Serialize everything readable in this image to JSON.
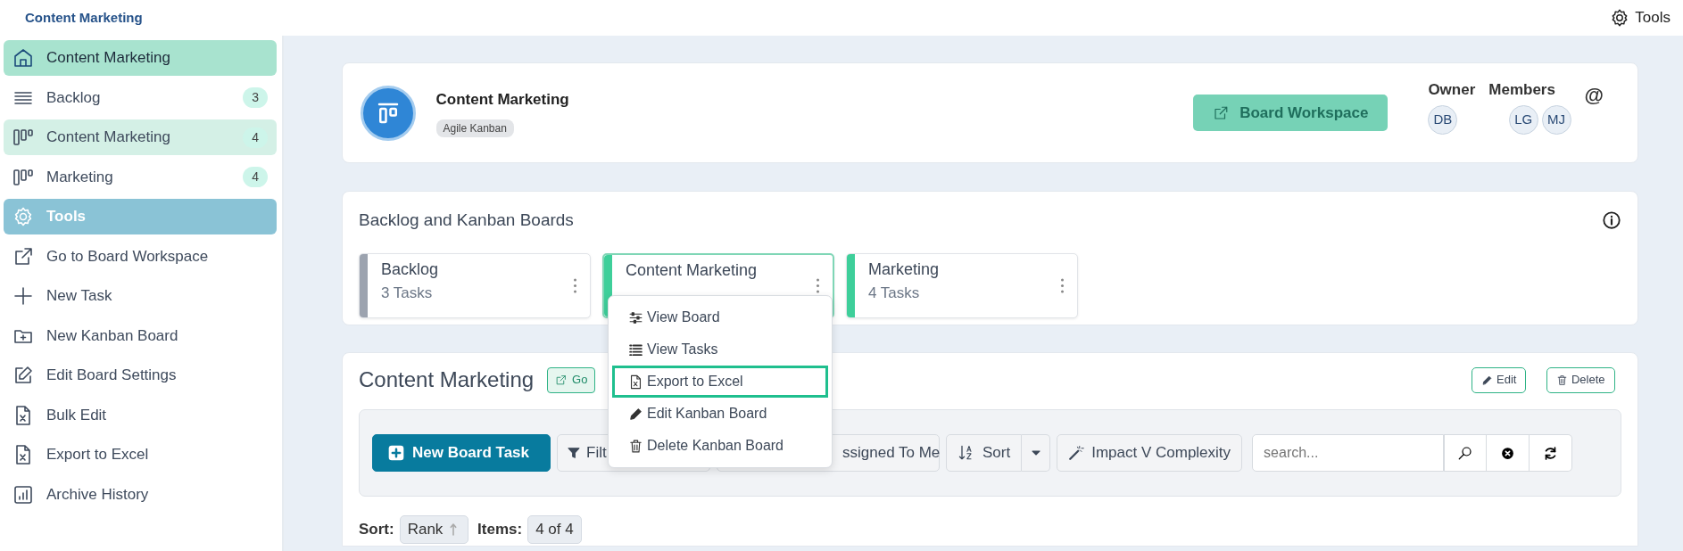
{
  "app_title": "Content Marketing",
  "top_tools": {
    "label": "Tools"
  },
  "sidebar": {
    "items": [
      {
        "kind": "home",
        "label": "Content Marketing",
        "selected": true
      },
      {
        "kind": "backlog",
        "label": "Backlog",
        "count": "3",
        "selected": false
      },
      {
        "kind": "board",
        "label": "Content Marketing",
        "count": "4",
        "selected": true
      },
      {
        "kind": "board",
        "label": "Marketing",
        "count": "4",
        "selected": false
      },
      {
        "kind": "section",
        "label": "Tools",
        "selected": false
      },
      {
        "kind": "link",
        "label": "Go to Board Workspace",
        "selected": false
      },
      {
        "kind": "add",
        "label": "New Task",
        "selected": false
      },
      {
        "kind": "folder",
        "label": "New Kanban Board",
        "selected": false
      },
      {
        "kind": "edit",
        "label": "Edit Board Settings",
        "selected": false
      },
      {
        "kind": "excel",
        "label": "Bulk Edit",
        "selected": false
      },
      {
        "kind": "excel",
        "label": "Export to Excel",
        "selected": false
      },
      {
        "kind": "chart",
        "label": "Archive History",
        "selected": false
      }
    ]
  },
  "header": {
    "title": "Content Marketing",
    "tag": "Agile Kanban",
    "workspace_button": "Board Workspace",
    "owner": {
      "label": "Owner",
      "avatars": [
        "DB"
      ]
    },
    "members": {
      "label": "Members",
      "avatars": [
        "LG",
        "MJ"
      ]
    },
    "mention": "@"
  },
  "boards": {
    "title": "Backlog and Kanban Boards",
    "items": [
      {
        "name": "Backlog",
        "tasks": "3 Tasks",
        "color": "#9ca3af",
        "selected": false
      },
      {
        "name": "Content Marketing",
        "color": "#3ecf9a",
        "selected": true
      },
      {
        "name": "Marketing",
        "tasks": "4 Tasks",
        "color": "#3ecf9a",
        "selected": false
      }
    ]
  },
  "menu": {
    "items": [
      {
        "kind": "sliders",
        "label": "View Board",
        "selected": false
      },
      {
        "kind": "list",
        "label": "View Tasks",
        "selected": false
      },
      {
        "kind": "excel",
        "label": "Export to Excel",
        "selected": true
      },
      {
        "kind": "pencil",
        "label": "Edit Kanban Board",
        "selected": false
      },
      {
        "kind": "trash",
        "label": "Delete Kanban Board",
        "selected": false
      }
    ]
  },
  "board_panel": {
    "title": "Content Marketing",
    "go_button": "Go",
    "edit_button": "Edit",
    "delete_button": "Delete",
    "toolbar": {
      "new_task": "New Board Task",
      "filter": "Filt",
      "assigned": "ssigned To Me",
      "sort": "Sort",
      "impact": "Impact V Complexity",
      "search": {
        "placeholder": "search..."
      }
    },
    "sort_line": {
      "sort_label": "Sort:",
      "sort_value": "Rank",
      "items_label": "Items:",
      "items_value": "4 of 4"
    }
  }
}
